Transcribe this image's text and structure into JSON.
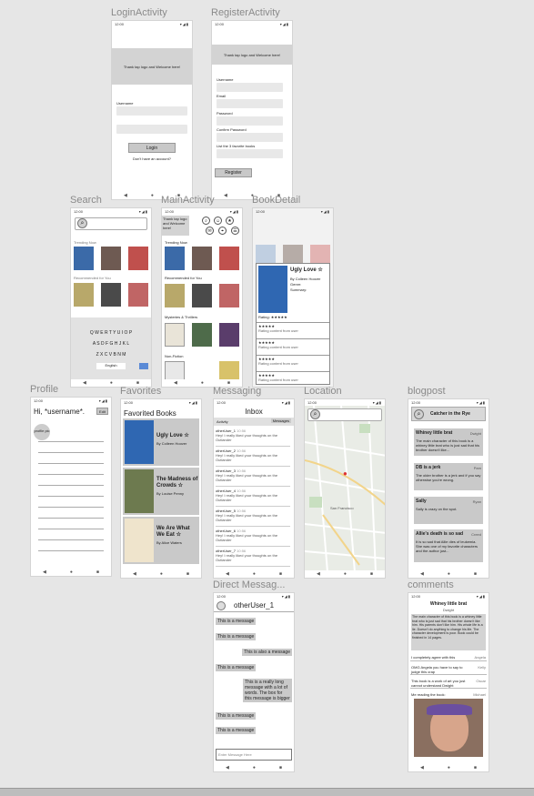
{
  "frames": {
    "login": "LoginActivity",
    "register": "RegisterActivity",
    "search": "Search",
    "main": "MainActivity",
    "bookdetail": "BookDetail",
    "profile": "Profile",
    "favorites": "Favorites",
    "messaging": "Messaging",
    "location": "Location",
    "blogpost": "blogpost",
    "direct": "Direct Messag...",
    "comments": "comments"
  },
  "status": {
    "time": "12:00",
    "signal": "▾◢▮"
  },
  "nav": {
    "back": "◀",
    "home": "●",
    "recent": "■"
  },
  "login": {
    "banner": "Thank tap logo and Welcome here!",
    "username_label": "Username",
    "login_button": "Login",
    "register_link": "Don't have an account?"
  },
  "register": {
    "banner": "Thank tap logo and Welcome here!",
    "username_label": "Username",
    "email_label": "Email",
    "password_label": "Password",
    "confirm_label": "Confirm Password",
    "books_label": "List the 3 favorite books",
    "register_button": "Register"
  },
  "search": {
    "trending": "Trending Now",
    "recommended": "Recommended for You",
    "keyboard_rows": [
      "Q W E R T Y U I O P",
      "A S D F G H J K L",
      "Z X C V B N M"
    ],
    "keyboard_lang": "English"
  },
  "main": {
    "welcome": "Thank tap logo and Welcome here!",
    "trending": "Trending Now",
    "recommended": "Recommended for You",
    "mysteries": "Mysteries & Thrillers",
    "nonfiction": "Non-Fiction"
  },
  "bookdetail": {
    "title": "Ugly Love",
    "author": "By Colleen Hoover",
    "genre": "Genre:",
    "summary": "Summary:",
    "rating": "Rating: ★★★★★",
    "review_stars": "★★★★★",
    "review_text": "Rating content from user"
  },
  "profile": {
    "greeting": "Hi, *username*.",
    "edit": "Edit",
    "avatar": "profile pic"
  },
  "favorites": {
    "heading": "Favorited Books",
    "books": [
      {
        "title": "Ugly Love ☆",
        "author": "By Colleen Hoover"
      },
      {
        "title": "The Madness of Crowds ☆",
        "author": "By Louise Penny"
      },
      {
        "title": "We Are What We Eat ☆",
        "author": "By Alice Waters"
      }
    ]
  },
  "messaging": {
    "title": "Inbox",
    "tab_activity": "Activity",
    "tab_messages": "Messages",
    "threads": [
      {
        "user": "otherUser_1",
        "time": "10:56",
        "preview": "Hey! I really liked your thoughts on the Outlander"
      },
      {
        "user": "otherUser_2",
        "time": "10:56",
        "preview": "Hey! I really liked your thoughts on the Outlander"
      },
      {
        "user": "otherUser_3",
        "time": "10:56",
        "preview": "Hey! I really liked your thoughts on the Outlander"
      },
      {
        "user": "otherUser_4",
        "time": "10:56",
        "preview": "Hey! I really liked your thoughts on the Outlander"
      },
      {
        "user": "otherUser_5",
        "time": "10:56",
        "preview": "Hey! I really liked your thoughts on the Outlander"
      },
      {
        "user": "otherUser_6",
        "time": "10:56",
        "preview": "Hey! I really liked your thoughts on the Outlander"
      },
      {
        "user": "otherUser_7",
        "time": "10:56",
        "preview": "Hey! I really liked your thoughts on the Outlander"
      }
    ]
  },
  "location": {
    "city": "San Francisco"
  },
  "blogpost": {
    "title": "Catcher in the Rye",
    "posts": [
      {
        "title": "Whiney little brat",
        "user": "Dwight",
        "body": "The main character of this book is a whiney little brat who is just sad that his brother doesn't like..."
      },
      {
        "title": "DB is a jerk",
        "user": "Pam",
        "body": "The older brother is a jerk and if you say otherwise you're wrong."
      },
      {
        "title": "Sally",
        "user": "Ryan",
        "body": "Sally is crazy on the spot."
      },
      {
        "title": "Allie's death is so sad",
        "user": "Creed",
        "body": "It is so sad that Allie dies of leukemia. She was one of my favorite characters and the author just..."
      }
    ]
  },
  "direct": {
    "user": "otherUser_1",
    "messages": [
      {
        "text": "This is a message",
        "side": "left"
      },
      {
        "text": "This is a message",
        "side": "left"
      },
      {
        "text": "This is also a message",
        "side": "right"
      },
      {
        "text": "This is a message",
        "side": "left"
      },
      {
        "text": "This is a really long message with a lot of words. The box for this message is bigger",
        "side": "right"
      },
      {
        "text": "This is a message",
        "side": "left"
      },
      {
        "text": "This is a message",
        "side": "left"
      }
    ],
    "input_placeholder": "Enter Message Here"
  },
  "comments": {
    "title": "Whiney little brat",
    "user": "Dwight",
    "body": "The main character of this book is a whiney little brat who is just sad that his brother doesn't like him. His parents don't like him. His whole life is a lie. Doesn't do anything to change his life. The character development is poor. Book could be finished in 14 pages.",
    "replies": [
      {
        "text": "I completely agree with this",
        "user": "Angela"
      },
      {
        "text": "OMG Angela you have to say to judge this crap",
        "user": "Kelly"
      },
      {
        "text": "This book is a work of art you just cannot understand Dwight",
        "user": "Oscar"
      },
      {
        "text": "Me reading the book:",
        "user": "Michael"
      }
    ]
  },
  "colors": {
    "background": "#e6e6e6",
    "panel": "#d3d3d3",
    "accent": "#c9c9c9"
  }
}
